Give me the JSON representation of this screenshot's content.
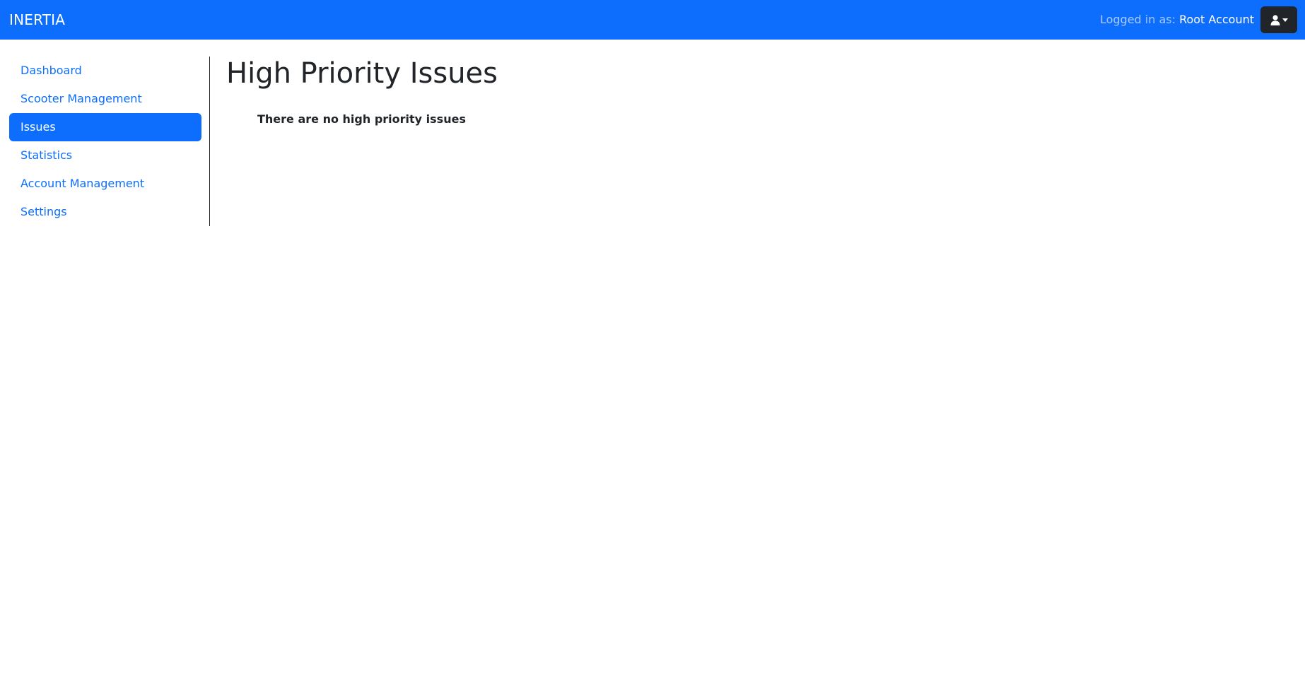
{
  "navbar": {
    "brand": "INERTIA",
    "logged_in_prefix": "Logged in as: ",
    "user_name": "Root Account",
    "user_menu_icon": "user-icon",
    "dropdown_icon": "caret-down-icon",
    "background_color": "#0d6efd"
  },
  "sidebar": {
    "items": [
      {
        "label": "Dashboard",
        "active": false
      },
      {
        "label": "Scooter Management",
        "active": false
      },
      {
        "label": "Issues",
        "active": true
      },
      {
        "label": "Statistics",
        "active": false
      },
      {
        "label": "Account Management",
        "active": false
      },
      {
        "label": "Settings",
        "active": false
      }
    ],
    "active_color": "#0d6efd"
  },
  "main": {
    "title": "High Priority Issues",
    "empty_message": "There are no high priority issues"
  }
}
